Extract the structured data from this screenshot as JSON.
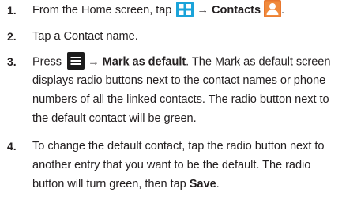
{
  "steps": [
    {
      "number": "1.",
      "lines": [
        {
          "pre": "From the Home screen, tap",
          "arrow": "→",
          "bold": "Contacts",
          "post": "."
        }
      ],
      "icons": [
        "apps-grid-icon",
        "contacts-icon"
      ]
    },
    {
      "number": "2.",
      "lines": [
        {
          "text": "Tap a Contact name."
        }
      ]
    },
    {
      "number": "3.",
      "lines": [
        {
          "pre": "Press",
          "arrow": "→",
          "bold": "Mark as default",
          "post": ". The Mark as default screen"
        },
        {
          "text": "displays radio buttons next to the contact names or phone"
        },
        {
          "text": "numbers of all the linked contacts. The radio button next to"
        },
        {
          "text": "the default contact will be green."
        }
      ],
      "icons": [
        "menu-icon"
      ]
    },
    {
      "number": "4.",
      "lines": [
        {
          "text": "To change the default contact, tap the radio button next to"
        },
        {
          "text": "another entry that you want to be the default. The radio"
        },
        {
          "pre": "button will turn green, then tap",
          "bold": "Save",
          "post": "."
        }
      ]
    }
  ],
  "colors": {
    "text": "#231f20",
    "apps_icon_fill": "#1aa3d9",
    "contacts_icon_fill": "#e8772e",
    "menu_icon_fill": "#1c1c1c"
  }
}
